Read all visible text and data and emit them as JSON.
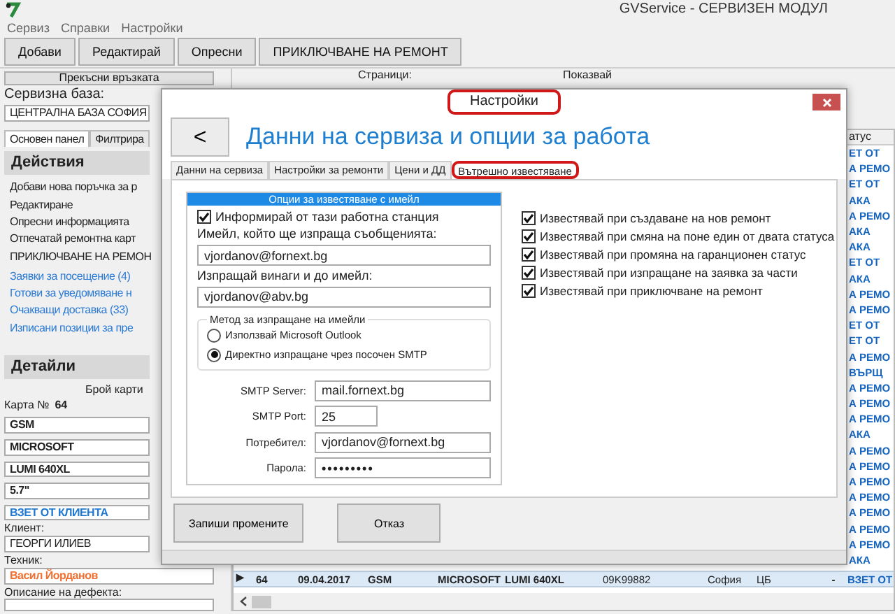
{
  "window": {
    "title": "GVService - СЕРВИЗЕН МОДУЛ"
  },
  "menu": [
    "Сервиз",
    "Справки",
    "Настройки"
  ],
  "toolbar": [
    "Добави",
    "Редактирай",
    "Опресни",
    "ПРИКЛЮЧВАНЕ НА РЕМОНТ"
  ],
  "connection": {
    "disconnect_button": "Прекъсни връзката",
    "base_label": "Сервизна база:",
    "base_value": "ЦЕНТРАЛНА БАЗА СОФИЯ"
  },
  "paging": {
    "pages_label": "Страници:",
    "show_label": "Показвай"
  },
  "side_tabs": [
    {
      "label": "Основен панел",
      "selected": true
    },
    {
      "label": "Филтрира",
      "selected": false
    }
  ],
  "actions": {
    "title": "Действия",
    "items": [
      {
        "label": "Добави нова поръчка за р",
        "kind": "command"
      },
      {
        "label": "Редактиране",
        "kind": "command"
      },
      {
        "label": "Опресни информацията",
        "kind": "command"
      },
      {
        "label": "Отпечатай ремонтна карт",
        "kind": "command"
      },
      {
        "label": "ПРИКЛЮЧВАНЕ НА РЕМОН",
        "kind": "command"
      },
      {
        "label": "Заявки за посещение (4)",
        "kind": "link"
      },
      {
        "label": "Готови за уведомяване н",
        "kind": "link"
      },
      {
        "label": "Очакващи доставка (33)",
        "kind": "link"
      },
      {
        "label": "Изписани позиции за пре",
        "kind": "link"
      }
    ]
  },
  "details": {
    "title": "Детайли",
    "cards_label": "Брой карти",
    "card_label": "Карта №",
    "card_number": "64",
    "fields": [
      "GSM",
      "MICROSOFT",
      "LUMI 640XL",
      "5.7\""
    ],
    "status": "ВЗЕТ ОТ КЛИЕНТА",
    "client_label": "Клиент:",
    "client": "ГЕОРГИ ИЛИЕВ",
    "technician_label": "Техник:",
    "technician": "Васил Йорданов",
    "defect_label": "Описание на дефекта:"
  },
  "grid": {
    "status_header": "атус",
    "rows": [
      {
        "status": "ЕТ ОТ",
        "selected": false
      },
      {
        "status": "А РЕМО",
        "selected": false
      },
      {
        "status": "ЕТ ОТ",
        "selected": false
      },
      {
        "status": "АКА",
        "selected": false
      },
      {
        "status": "А РЕМО",
        "selected": false
      },
      {
        "status": "АКА",
        "selected": false
      },
      {
        "status": "АКА",
        "selected": false
      },
      {
        "status": "ЕТ ОТ",
        "selected": false
      },
      {
        "status": "АКА",
        "selected": false
      },
      {
        "status": "А РЕМО",
        "selected": false
      },
      {
        "status": "А РЕМО",
        "selected": false
      },
      {
        "status": "ЕТ ОТ",
        "selected": false
      },
      {
        "status": "ЕТ ОТ",
        "selected": false
      },
      {
        "status": "А РЕМО",
        "selected": false
      },
      {
        "status": "ВЪРЩ",
        "selected": false
      },
      {
        "status": "А РЕМО",
        "selected": false
      },
      {
        "status": "А РЕМО",
        "selected": false
      },
      {
        "status": "А РЕМО",
        "selected": false
      },
      {
        "status": "АКА",
        "selected": false
      },
      {
        "status": "А РЕМО",
        "selected": false
      },
      {
        "status": "А РЕМО",
        "selected": false
      },
      {
        "status": "А РЕМО",
        "selected": false
      },
      {
        "status": "А РЕМО",
        "selected": false
      },
      {
        "status": "А РЕМО",
        "selected": false
      },
      {
        "status": "А РЕМО",
        "selected": false
      },
      {
        "status": "А РЕМО",
        "selected": false
      },
      {
        "status": "АКА",
        "selected": false
      }
    ],
    "current_row": {
      "marker": "▶",
      "selected": true,
      "cells": [
        "64",
        "09.04.2017",
        "GSM",
        "MICROSOFT",
        "LUMI 640XL",
        "09K99882",
        "София",
        "ЦБ",
        "-",
        "ВЗЕТ ОТ"
      ]
    }
  },
  "dialog": {
    "title": "Настройки",
    "title_annotated": true,
    "back_button": "<",
    "heading": "Данни на сервиза и опции за работа",
    "tabs": [
      {
        "label": "Данни на сервиза",
        "selected": false,
        "annotated": false
      },
      {
        "label": "Настройки за ремонти",
        "selected": false,
        "annotated": false
      },
      {
        "label": "Цени и ДД",
        "selected": false,
        "annotated": false
      },
      {
        "label": "Вътрешно известяване",
        "selected": true,
        "annotated": true
      }
    ],
    "email_group": {
      "title": "Опции за известяване с имейл",
      "inform": {
        "label": "Информирай от тази работна станция",
        "checked": true
      },
      "sender_label": "Имейл, който ще изпраща съобщенията:",
      "sender": "vjordanov@fornext.bg",
      "copy_label": "Изпращай винаги и до имейл:",
      "copy": "vjordanov@abv.bg",
      "method": {
        "title": "Метод за изпращане на имейли",
        "options": [
          {
            "label": "Използвай Microsoft Outlook",
            "selected": false
          },
          {
            "label": "Директно изпращане чрез посочен SMTP",
            "selected": true
          }
        ]
      },
      "smtp_fields": [
        {
          "label": "SMTP Server:",
          "value": "mail.fornext.bg",
          "kind": "text"
        },
        {
          "label": "SMTP Port:",
          "value": "25",
          "kind": "short"
        },
        {
          "label": "Потребител:",
          "value": "vjordanov@fornext.bg",
          "kind": "text"
        },
        {
          "label": "Парола:",
          "value": "•••••••••",
          "kind": "password"
        }
      ]
    },
    "notify_options": [
      {
        "label": "Известявай при създаване на нов ремонт",
        "checked": true
      },
      {
        "label": "Известявай при смяна на поне един от двата статуса",
        "checked": true
      },
      {
        "label": "Известявай при промяна на гаранционен статус",
        "checked": true
      },
      {
        "label": "Известявай при изпращане на заявка за части",
        "checked": true
      },
      {
        "label": "Известявай при приключване на ремонт",
        "checked": true
      }
    ],
    "buttons": [
      "Запиши промените",
      "Отказ"
    ]
  }
}
